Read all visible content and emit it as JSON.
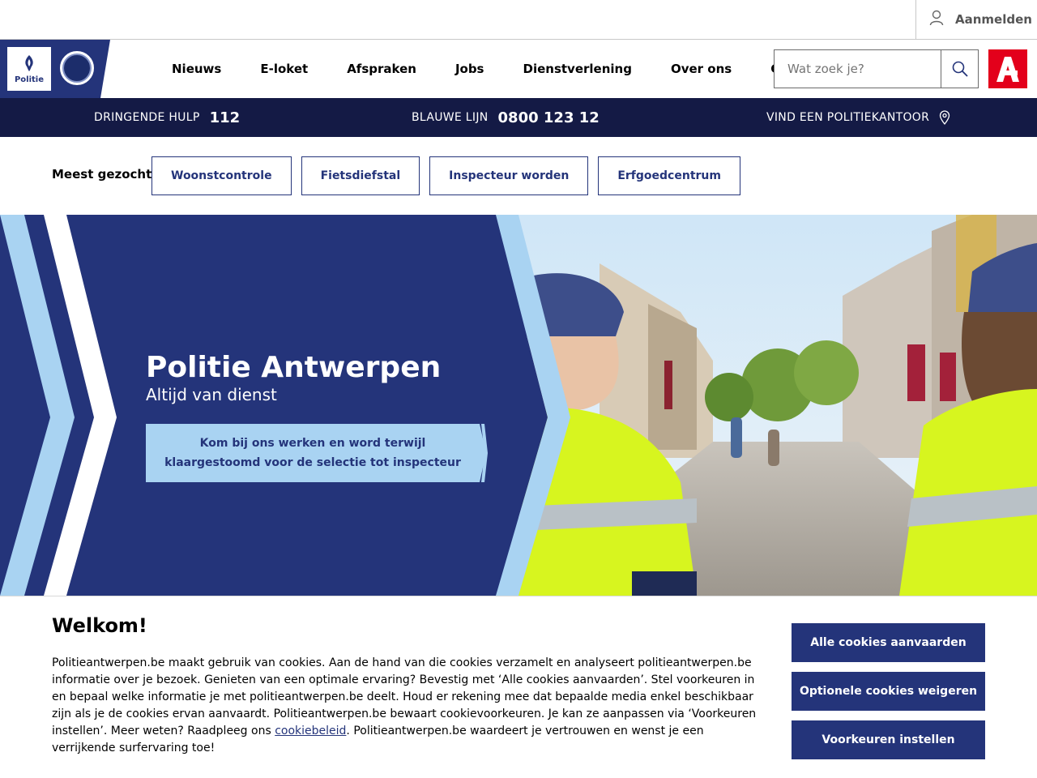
{
  "topbar": {
    "login_label": "Aanmelden",
    "login_icon": "user-icon"
  },
  "header": {
    "logo_text": "Politie",
    "nav": [
      "Nieuws",
      "E-loket",
      "Afspraken",
      "Jobs",
      "Dienstverlening",
      "Over ons",
      "Contact"
    ],
    "search_placeholder": "Wat zoek je?",
    "brand_letter": "A"
  },
  "infobar": {
    "urgent_label": "DRINGENDE HULP",
    "urgent_number": "112",
    "blue_label": "BLAUWE LIJN",
    "blue_number": "0800 123 12",
    "office_label": "VIND EEN POLITIEKANTOOR"
  },
  "popular": {
    "title": "Meest gezocht",
    "tags": [
      "Woonstcontrole",
      "Fietsdiefstal",
      "Inspecteur worden",
      "Erfgoedcentrum"
    ]
  },
  "hero": {
    "title": "Politie Antwerpen",
    "subtitle": "Altijd van dienst",
    "cta": "Kom bij ons werken en word terwijl klaargestoomd voor de selectie tot inspecteur"
  },
  "cookie": {
    "title": "Welkom!",
    "text_before": "Politieantwerpen.be maakt gebruik van cookies. Aan de hand van die cookies verzamelt en analyseert politieantwerpen.be informatie over je bezoek. Genieten van een optimale ervaring? Bevestig met ‘Alle cookies aanvaarden’. Stel voorkeuren in en bepaal welke informatie je met politieantwerpen.be deelt. Houd er rekening mee dat bepaalde media enkel beschikbaar zijn als je de cookies ervan aanvaardt. Politieantwerpen.be bewaart cookievoorkeuren. Je kan ze aanpassen via ‘Voorkeuren instellen’. Meer weten? Raadpleeg ons ",
    "link": "cookiebeleid",
    "text_after": ". Politieantwerpen.be waardeert je vertrouwen en wenst je een verrijkende surfervaring toe!",
    "btn_accept": "Alle cookies aanvaarden",
    "btn_refuse": "Optionele cookies weigeren",
    "btn_prefs": "Voorkeuren instellen"
  },
  "colors": {
    "navy": "#24347a",
    "dark_navy": "#141a45",
    "light_blue": "#a9d3f2",
    "brand_red": "#e3001b"
  }
}
